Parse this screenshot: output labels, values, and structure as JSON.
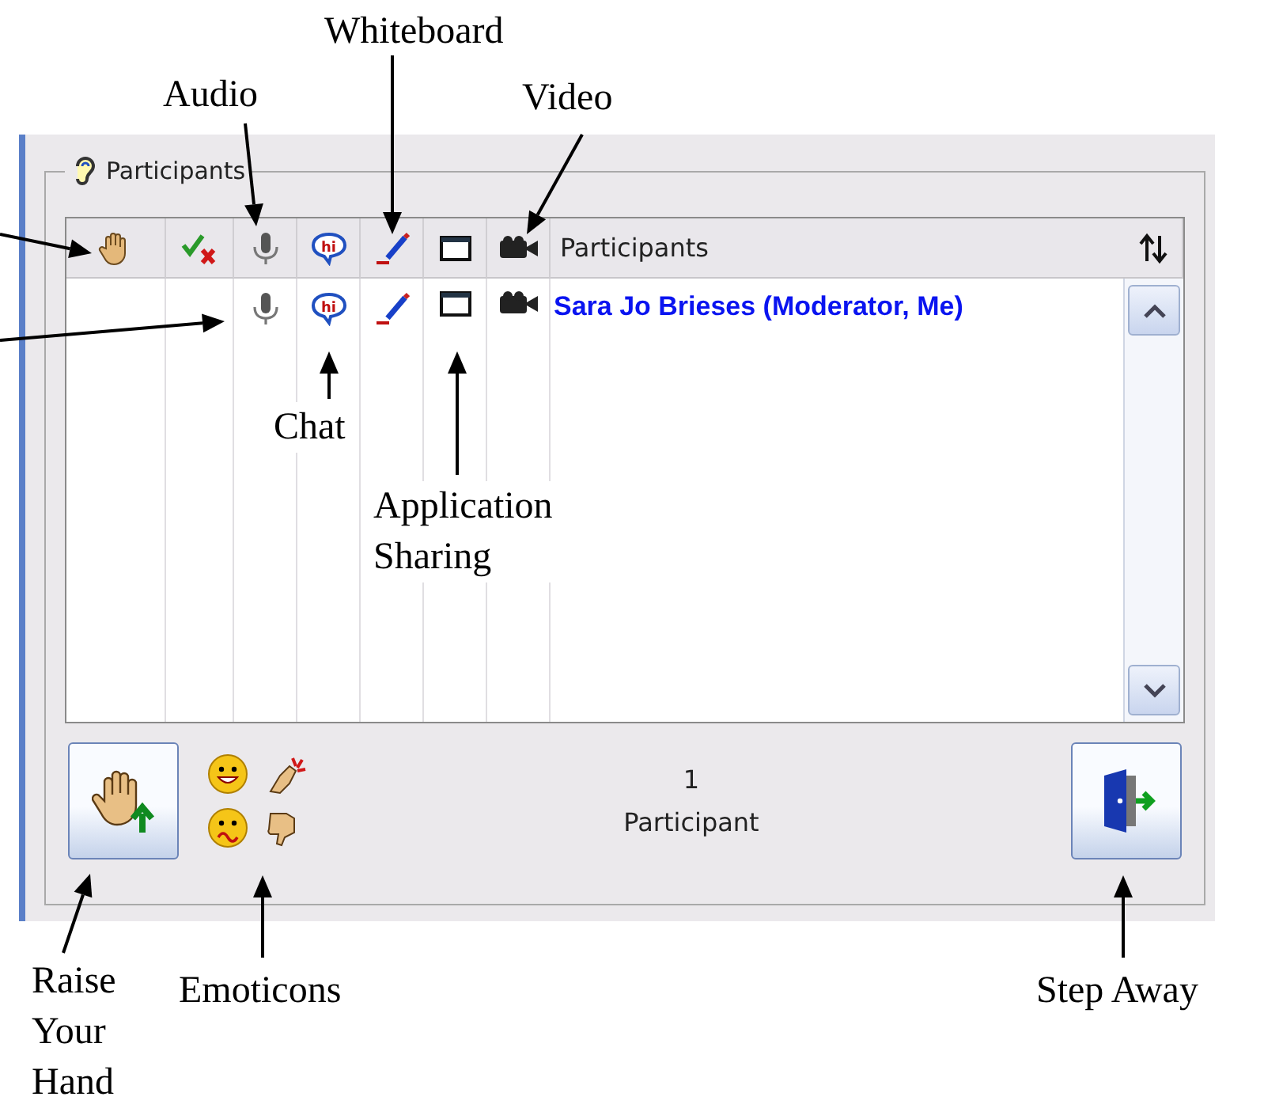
{
  "panel": {
    "title": "Participants"
  },
  "table": {
    "header": "Participants",
    "header_chat_glyph": "hi",
    "rows": [
      {
        "name": "Sara Jo Brieses (Moderator, Me)",
        "hand_raised": false,
        "status_mark": false,
        "audio": true,
        "chat": true,
        "chat_glyph": "hi",
        "whiteboard": true,
        "app_sharing": true,
        "video": true
      }
    ]
  },
  "footer": {
    "count": "1",
    "count_label": "Participant"
  },
  "annotations": [
    {
      "text": "Whiteboard"
    },
    {
      "text": "Audio"
    },
    {
      "text": "Video"
    },
    {
      "text": "Chat"
    },
    {
      "text": "Application Sharing"
    },
    {
      "text": "Raise Your Hand"
    },
    {
      "text": "Emoticons"
    },
    {
      "text": "Step Away"
    }
  ]
}
